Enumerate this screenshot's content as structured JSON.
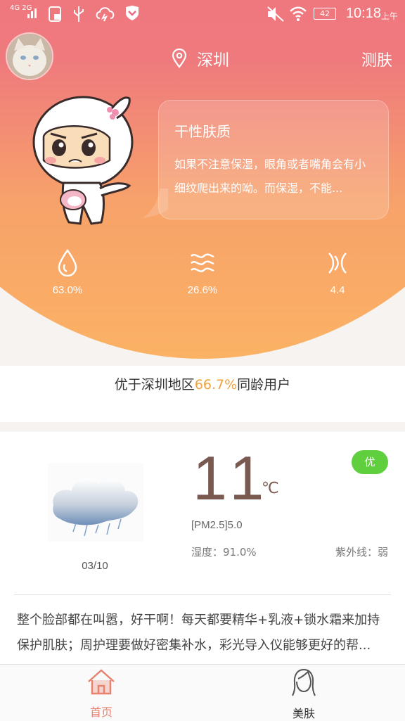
{
  "status_bar": {
    "network_label": "4G 2G",
    "battery": "42",
    "time": "10:18",
    "ampm": "上午"
  },
  "header": {
    "location": "深圳",
    "measure_label": "测肤"
  },
  "skin": {
    "type_title": "干性肤质",
    "description": "如果不注意保湿，眼角或者嘴角会有小细纹爬出来的呦。而保湿，不能..."
  },
  "stats": [
    {
      "icon": "water-drop-icon",
      "value": "63.0%"
    },
    {
      "icon": "oil-wave-icon",
      "value": "26.6%"
    },
    {
      "icon": "elasticity-icon",
      "value": "4.4"
    }
  ],
  "ranking": {
    "prefix": "优于深圳地区",
    "percent": "66.7%",
    "suffix": "同龄用户"
  },
  "weather": {
    "icon": "rain-cloud-icon",
    "date": "03/10",
    "temperature": "11",
    "unit": "℃",
    "quality_badge": "优",
    "pm25": "[PM2.5]5.0",
    "humidity": "湿度：91.0%",
    "uv": "紫外线：弱",
    "tip": "整个脸部都在叫嚣，好干啊！每天都要精华+乳液+锁水霜来加持保护肌肤；周护理要做好密集补水，彩光导入仪能够更好的帮..."
  },
  "colors": {
    "accent_orange": "#f2a23c",
    "badge_green": "#5fcf3e",
    "active_tab": "#e8826e"
  },
  "tabs": [
    {
      "label": "首页",
      "icon": "home-icon",
      "active": true
    },
    {
      "label": "美肤",
      "icon": "woman-face-icon",
      "active": false
    }
  ]
}
